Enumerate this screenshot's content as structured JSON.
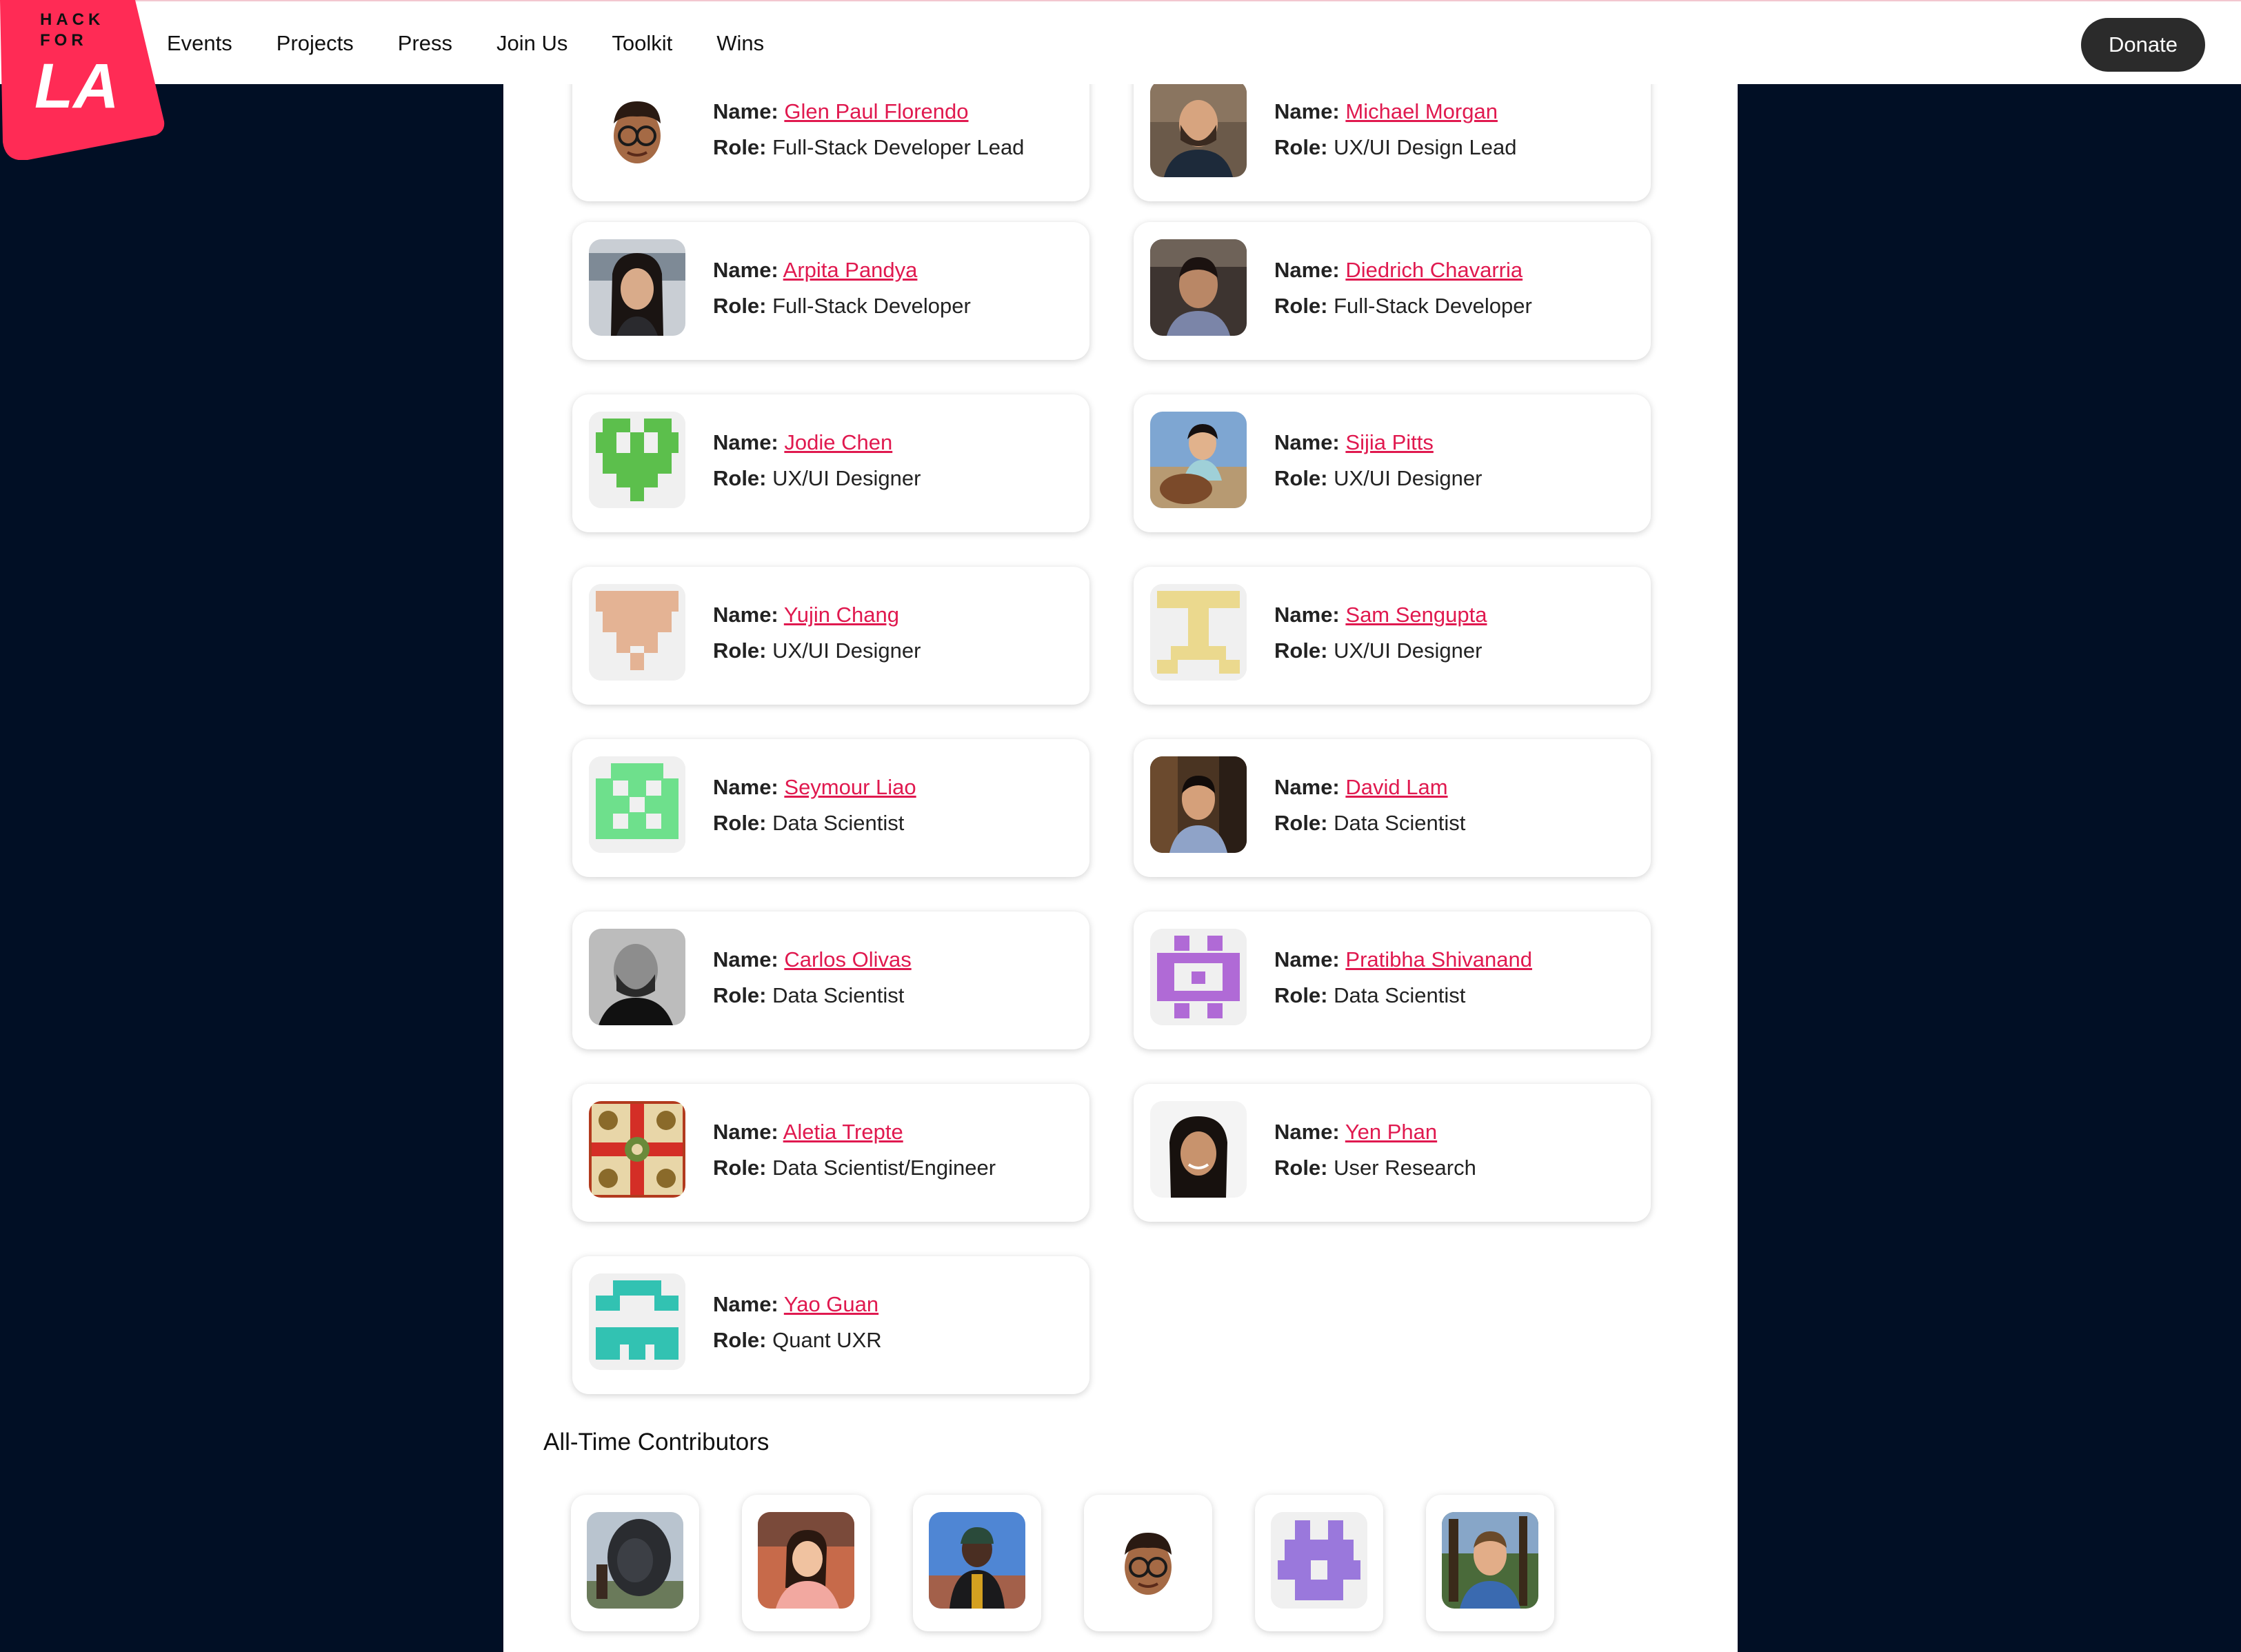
{
  "header": {
    "logo_text": [
      "HACK",
      "FOR",
      "LA"
    ],
    "nav": [
      "Events",
      "Projects",
      "Press",
      "Join Us",
      "Toolkit",
      "Wins"
    ],
    "donate_label": "Donate",
    "brand_color": "#ff2b55"
  },
  "team": {
    "name_label": "Name:",
    "role_label": "Role:",
    "members": [
      {
        "name": "Glen Paul Florendo",
        "role": "Full-Stack Developer Lead",
        "avatar": "memoji-glasses"
      },
      {
        "name": "Michael Morgan",
        "role": "UX/UI Design Lead",
        "avatar": "photo-bearded-man"
      },
      {
        "name": "Arpita Pandya",
        "role": "Full-Stack Developer",
        "avatar": "photo-woman-long-hair"
      },
      {
        "name": "Diedrich Chavarria",
        "role": "Full-Stack Developer",
        "avatar": "photo-man-dark-room"
      },
      {
        "name": "Jodie Chen",
        "role": "UX/UI Designer",
        "avatar": "identicon-green"
      },
      {
        "name": "Sijia Pitts",
        "role": "UX/UI Designer",
        "avatar": "photo-woman-with-dog"
      },
      {
        "name": "Yujin Chang",
        "role": "UX/UI Designer",
        "avatar": "identicon-tan"
      },
      {
        "name": "Sam Sengupta",
        "role": "UX/UI Designer",
        "avatar": "identicon-yellow"
      },
      {
        "name": "Seymour Liao",
        "role": "Data Scientist",
        "avatar": "identicon-mint"
      },
      {
        "name": "David Lam",
        "role": "Data Scientist",
        "avatar": "photo-man-smiling"
      },
      {
        "name": "Carlos Olivas",
        "role": "Data Scientist",
        "avatar": "photo-bw-man"
      },
      {
        "name": "Pratibha Shivanand",
        "role": "Data Scientist",
        "avatar": "identicon-purple"
      },
      {
        "name": "Aletia Trepte",
        "role": "Data Scientist/Engineer",
        "avatar": "pattern-tile"
      },
      {
        "name": "Yen Phan",
        "role": "User Research",
        "avatar": "photo-woman-smiling"
      },
      {
        "name": "Yao Guan",
        "role": "Quant UXR",
        "avatar": "identicon-teal"
      }
    ]
  },
  "contributors": {
    "title": "All-Time Contributors",
    "avatars": [
      "photo-statue",
      "photo-woman-restaurant",
      "photo-man-outdoors",
      "memoji-glasses",
      "identicon-purple-cross",
      "photo-man-trees"
    ]
  },
  "colors": {
    "page_background": "#010f25",
    "link": "#e0194f",
    "donate_button": "#2b2b2b"
  }
}
